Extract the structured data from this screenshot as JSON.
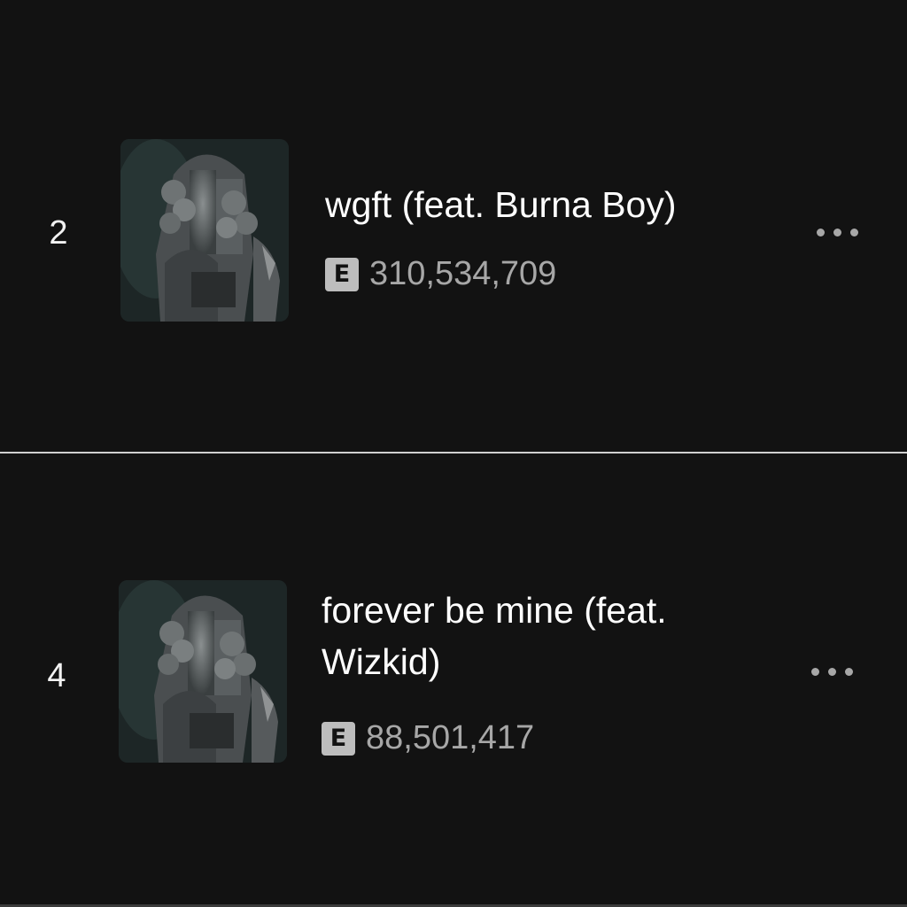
{
  "tracks": [
    {
      "rank": "2",
      "title": "wgft (feat. Burna Boy)",
      "explicit_badge": "E",
      "plays": "310,534,709",
      "artwork_icon": "album-artwork",
      "more_icon": "more-options-icon"
    },
    {
      "rank": "4",
      "title": "forever be mine (feat. Wizkid)",
      "explicit_badge": "E",
      "plays": "88,501,417",
      "artwork_icon": "album-artwork",
      "more_icon": "more-options-icon"
    }
  ],
  "colors": {
    "background": "#121212",
    "primary_text": "#ffffff",
    "secondary_text": "#a7a7a7",
    "explicit_badge_bg": "#bdbdbd",
    "divider": "#cfcfcf"
  }
}
